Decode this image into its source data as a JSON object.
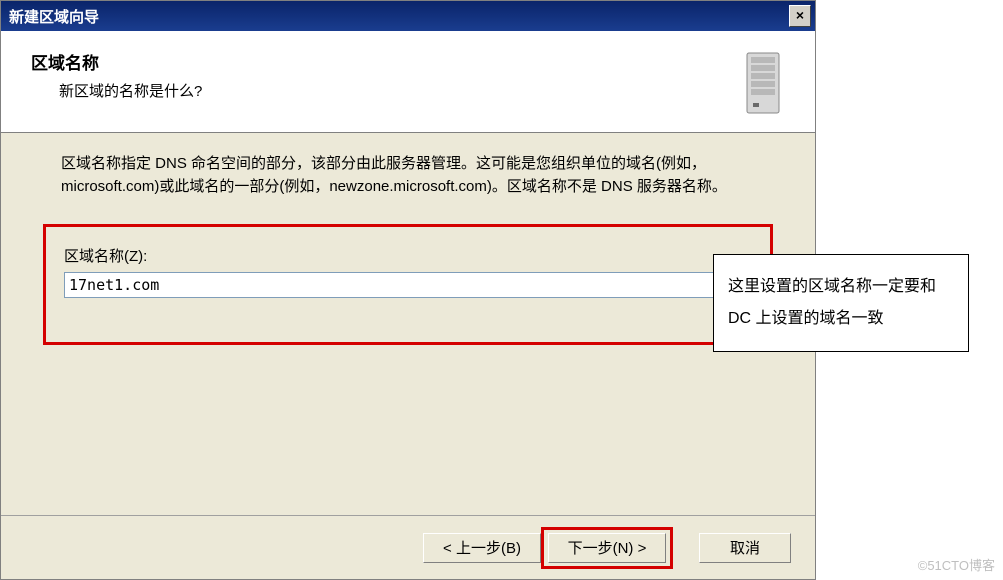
{
  "title": "新建区域向导",
  "header": {
    "title": "区域名称",
    "subtitle": "新区域的名称是什么?"
  },
  "description": "区域名称指定 DNS 命名空间的部分，该部分由此服务器管理。这可能是您组织单位的域名(例如，microsoft.com)或此域名的一部分(例如，newzone.microsoft.com)。区域名称不是 DNS 服务器名称。",
  "field": {
    "label": "区域名称(Z):",
    "value": "17net1.com"
  },
  "buttons": {
    "back": "< 上一步(B)",
    "next": "下一步(N) >",
    "cancel": "取消"
  },
  "annotation": "这里设置的区域名称一定要和 DC 上设置的域名一致",
  "watermark": "©51CTO博客",
  "colors": {
    "highlight": "#d40000"
  }
}
